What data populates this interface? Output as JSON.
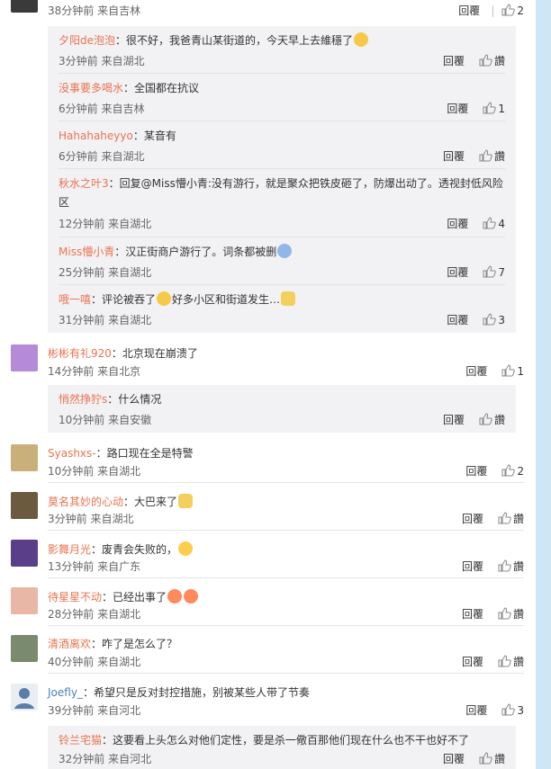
{
  "ui": {
    "reply": "回覆",
    "like_zero": "讚",
    "colon": "："
  },
  "top_comment_meta": {
    "time": "38分钟前",
    "source": "来自吉林",
    "likes": "2"
  },
  "thread1_replies": [
    {
      "user": "夕阳de泡泡",
      "text": "很不好，我爸青山某街道的，今天早上去維穩了",
      "emoji": "crying-laughing-emoji",
      "time": "3分钟前",
      "source": "来自湖北",
      "likes": "讚"
    },
    {
      "user": "没事要多喝水",
      "text": "全国都在抗议",
      "time": "6分钟前",
      "source": "来自吉林",
      "likes": "1"
    },
    {
      "user": "Hahahaheyyo",
      "text": "某音有",
      "time": "6分钟前",
      "source": "来自湖北",
      "likes": "讚"
    },
    {
      "user": "秋水之叶3",
      "text": "回复@Miss懵小青:没有游行，就是聚众把铁皮砸了，防爆出动了。透视封低风险区",
      "time": "12分钟前",
      "source": "来自湖北",
      "likes": "4"
    },
    {
      "user": "Miss懵小青",
      "text": "汉正街商户游行了。词条都被删",
      "emoji": "shocked-emoji",
      "time": "25分钟前",
      "source": "来自湖北",
      "likes": "7"
    },
    {
      "user": "哦一嘻",
      "text": "评论被吞了",
      "text2": "好多小区和街道发生…",
      "emoji": "crying-laughing-emoji",
      "emoji2": "cat-emoji",
      "time": "31分钟前",
      "source": "来自湖北",
      "likes": "3"
    }
  ],
  "comments": [
    {
      "user": "彬彬有礼920",
      "text": "北京现在崩溃了",
      "time": "14分钟前",
      "source": "来自北京",
      "likes": "1",
      "avatar": "photo-avatar",
      "avatar_color": "#b58ad6"
    },
    {
      "user": "Syashxs-",
      "text": "路口现在全是特警",
      "time": "10分钟前",
      "source": "来自湖北",
      "likes": "2",
      "avatar": "photo-avatar",
      "avatar_color": "#c9b07a"
    },
    {
      "user": "莫名其妙的心动",
      "text": "大巴来了",
      "emoji": "cat-emoji",
      "time": "3分钟前",
      "source": "来自湖北",
      "likes": "讚",
      "avatar": "photo-avatar",
      "avatar_color": "#6b5a3e"
    },
    {
      "user": "影舞月光",
      "text": "废青会失败的，",
      "emoji": "laughing-emoji",
      "time": "13分钟前",
      "source": "来自广东",
      "likes": "讚",
      "avatar": "anime-avatar",
      "avatar_color": "#5a3e8a"
    },
    {
      "user": "待星星不动",
      "text": "已经出事了",
      "emoji": "explosion-emoji",
      "time": "28分钟前",
      "source": "来自湖北",
      "likes": "讚",
      "avatar": "photo-avatar",
      "avatar_color": "#e8b7a5"
    },
    {
      "user": "清酒离欢",
      "text": "咋了是怎么了？",
      "time": "40分钟前",
      "source": "来自湖北",
      "likes": "讚",
      "avatar": "photo-avatar",
      "avatar_color": "#7a8a6e"
    },
    {
      "user": "Joefly_",
      "text": "希望只是反对封控措施，别被某些人带了节奏",
      "time": "39分钟前",
      "source": "来自河北",
      "likes": "3",
      "avatar": "default-avatar",
      "avatar_color": "#e9eef3"
    }
  ],
  "thread_replies_b": [
    {
      "user": "悄然挣狞s",
      "text": "什么情况",
      "time": "10分钟前",
      "source": "来自安徽",
      "likes": "讚"
    }
  ],
  "thread_replies_c": [
    {
      "user": "铃兰宅猫",
      "text": "这要看上头怎么对他们定性，要是杀一儆百那他们现在什么也不干也好不了",
      "time": "32分钟前",
      "source": "来自河北",
      "likes": "讚"
    }
  ],
  "colors": {
    "username": "#eb7350",
    "accent_strip": "#cfe6f5",
    "reply_bg": "#f2f2f5"
  }
}
